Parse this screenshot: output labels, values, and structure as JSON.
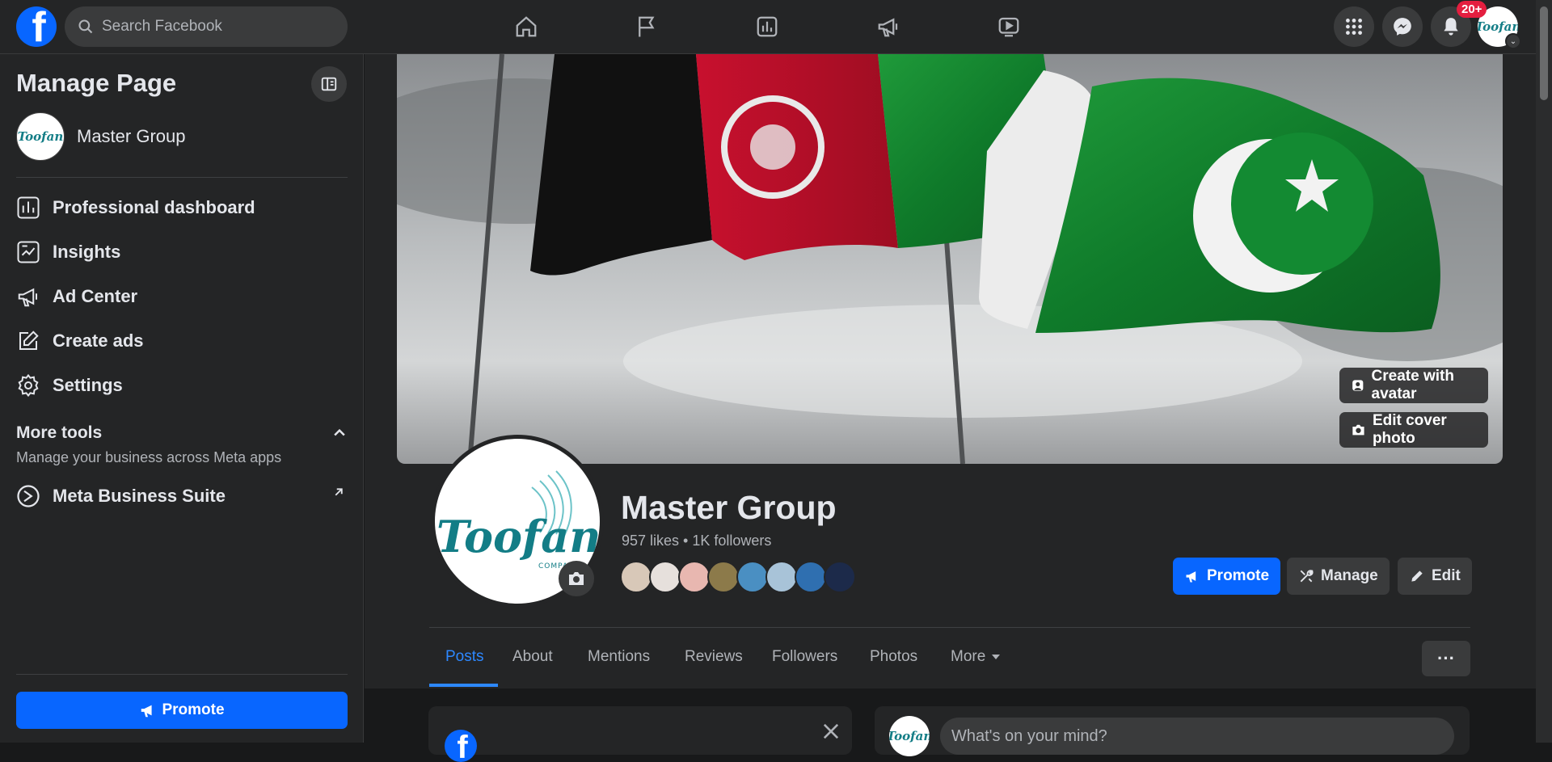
{
  "topbar": {
    "search_placeholder": "Search Facebook",
    "notification_badge": "20+",
    "nav_icons": [
      "home-icon",
      "flag-icon",
      "insights-icon",
      "megaphone-icon",
      "video-icon"
    ],
    "right_icons": [
      "menu-grid-icon",
      "messenger-icon",
      "bell-icon"
    ]
  },
  "sidebar": {
    "title": "Manage Page",
    "page_name": "Master Group",
    "items": [
      {
        "label": "Professional dashboard",
        "icon": "dashboard-icon"
      },
      {
        "label": "Insights",
        "icon": "insights-icon"
      },
      {
        "label": "Ad Center",
        "icon": "megaphone-icon"
      },
      {
        "label": "Create ads",
        "icon": "edit-icon"
      },
      {
        "label": "Settings",
        "icon": "gear-icon"
      }
    ],
    "more_tools": {
      "title": "More tools",
      "subtitle": "Manage your business across Meta apps",
      "item": "Meta Business Suite"
    },
    "promote_label": "Promote"
  },
  "page": {
    "name": "Master Group",
    "stats": "957 likes • 1K followers",
    "logo_text": "Toofan",
    "logo_sub": "COMPANY",
    "cover_buttons": {
      "avatar": "Create with avatar",
      "edit_cover": "Edit cover photo"
    },
    "actions": {
      "promote": "Promote",
      "manage": "Manage",
      "edit": "Edit"
    },
    "tabs": [
      "Posts",
      "About",
      "Mentions",
      "Reviews",
      "Followers",
      "Photos",
      "More"
    ],
    "active_tab": "Posts",
    "composer_placeholder": "What's on your mind?"
  },
  "colors": {
    "accent": "#0866ff",
    "badge": "#e41e3f",
    "background": "#18191a",
    "surface": "#242526"
  }
}
